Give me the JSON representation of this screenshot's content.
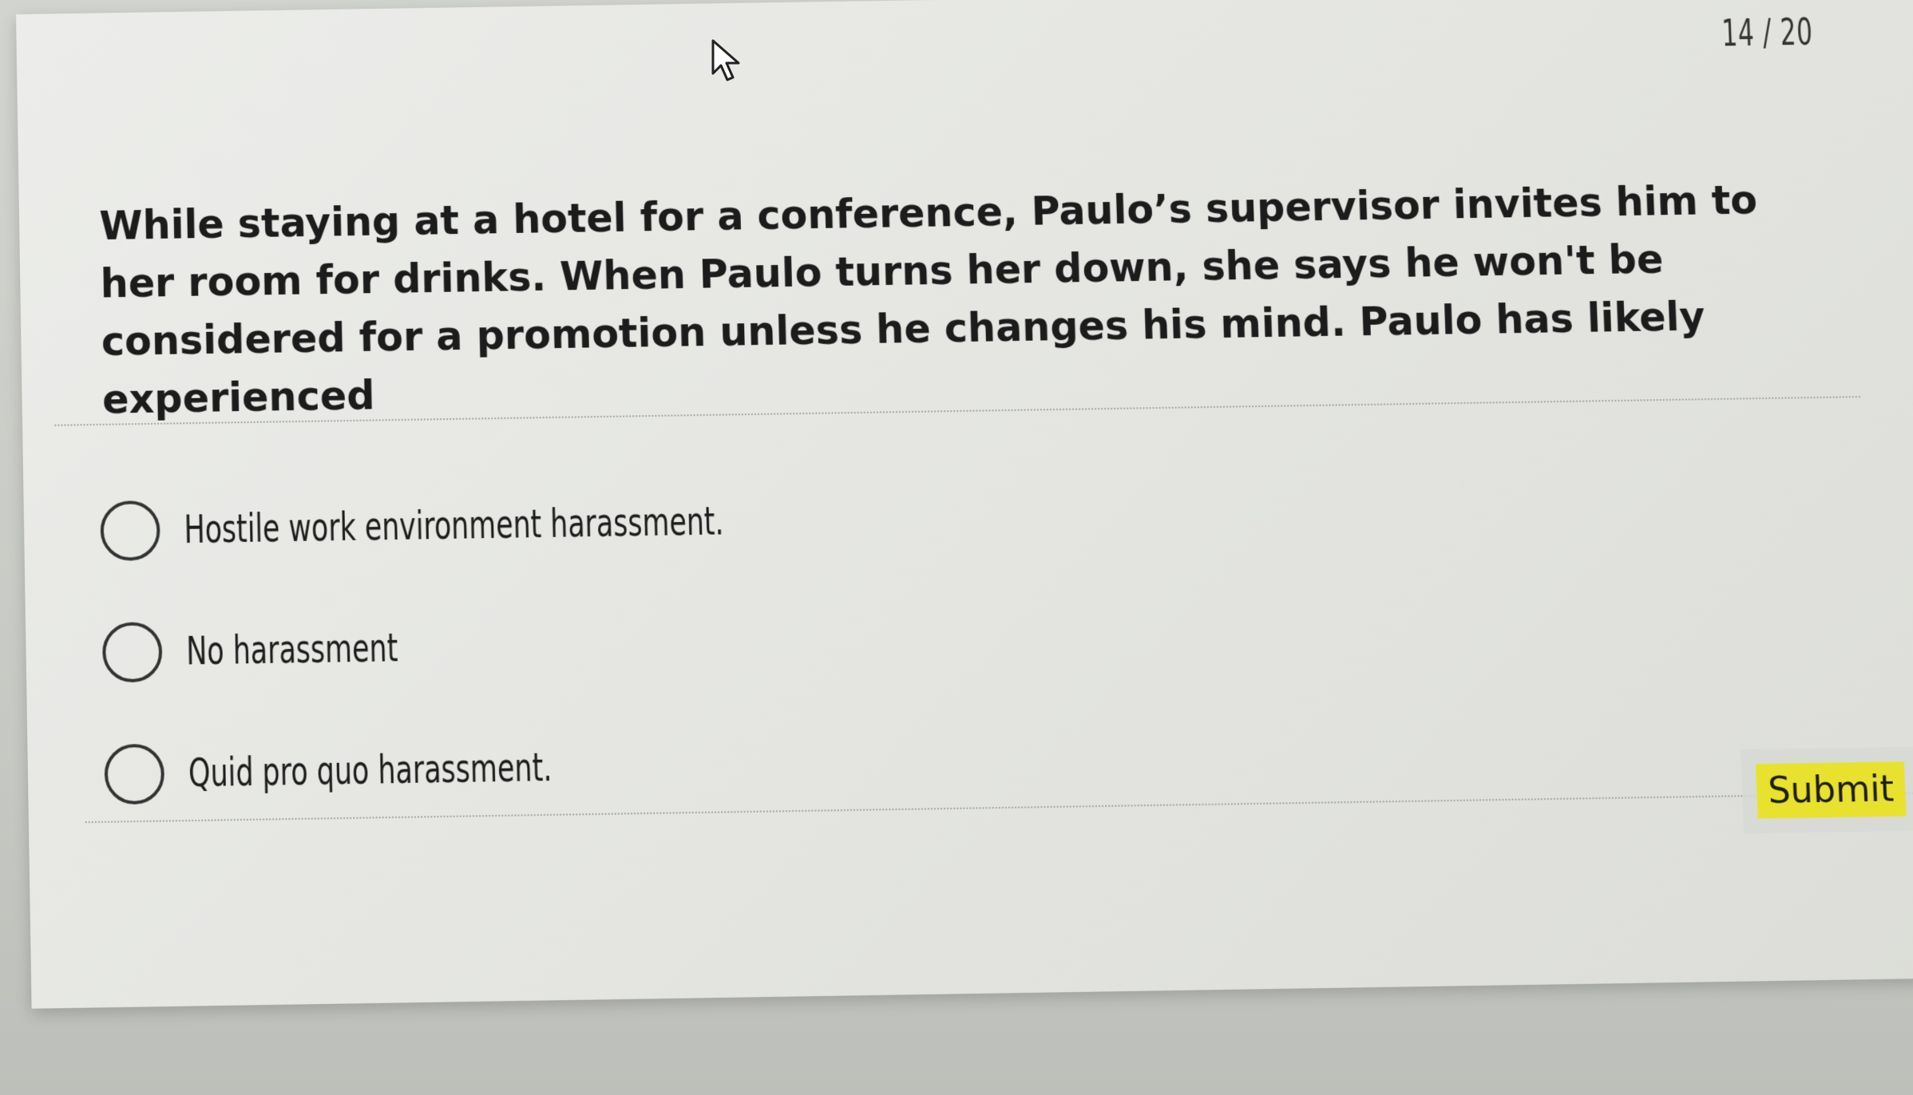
{
  "quiz": {
    "progress": "14 / 20",
    "question": "While staying at a hotel for a conference, Paulo’s supervisor invites him to her room for drinks. When Paulo turns her down, she says he won't be considered for a promotion unless he changes his mind. Paulo has likely experienced",
    "options": [
      {
        "label": "Hostile work environment harassment.",
        "selected": false
      },
      {
        "label": "No harassment",
        "selected": false
      },
      {
        "label": "Quid pro quo harassment.",
        "selected": false
      }
    ],
    "submit_label": "Submit"
  },
  "colors": {
    "submit_bg": "#e8e22e",
    "card_bg": "#e8e9e5",
    "text": "#1c1c1c"
  },
  "icons": {
    "cursor": "mouse-pointer-icon",
    "radio": "radio-unselected-icon"
  }
}
